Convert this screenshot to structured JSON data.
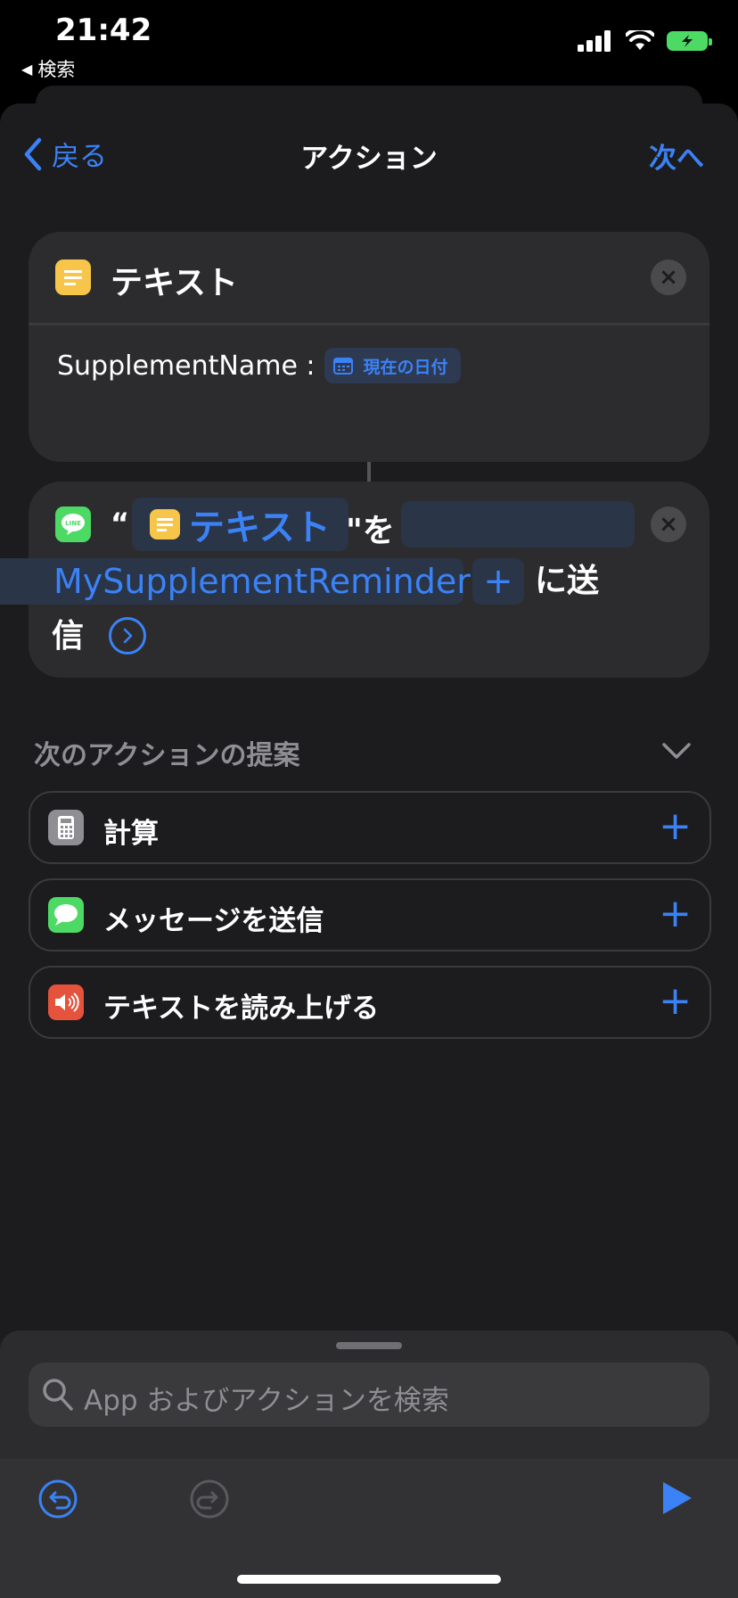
{
  "status_bar": {
    "time": "21:42",
    "back_app": "検索"
  },
  "nav": {
    "back": "戻る",
    "title": "アクション",
    "next": "次へ"
  },
  "text_action": {
    "title": "テキスト",
    "content_prefix": "SupplementName :",
    "variable": "現在の日付"
  },
  "line_action": {
    "quote_open": "“",
    "variable": "テキスト",
    "quote_close": "\"を",
    "recipient": "MySupplementReminder",
    "send_part1": "に送",
    "send_part2": "信"
  },
  "suggestions": {
    "title": "次のアクションの提案",
    "items": [
      {
        "label": "計算",
        "icon": "calculator-icon",
        "color": "#8e8e93"
      },
      {
        "label": "メッセージを送信",
        "icon": "messages-icon",
        "color": "#4cd964"
      },
      {
        "label": "テキストを読み上げる",
        "icon": "speaker-icon",
        "color": "#e5533d"
      }
    ]
  },
  "search": {
    "placeholder": "App およびアクションを検索"
  },
  "colors": {
    "accent": "#3b82f6",
    "background": "#1c1c1e",
    "card": "#2c2c2e"
  }
}
